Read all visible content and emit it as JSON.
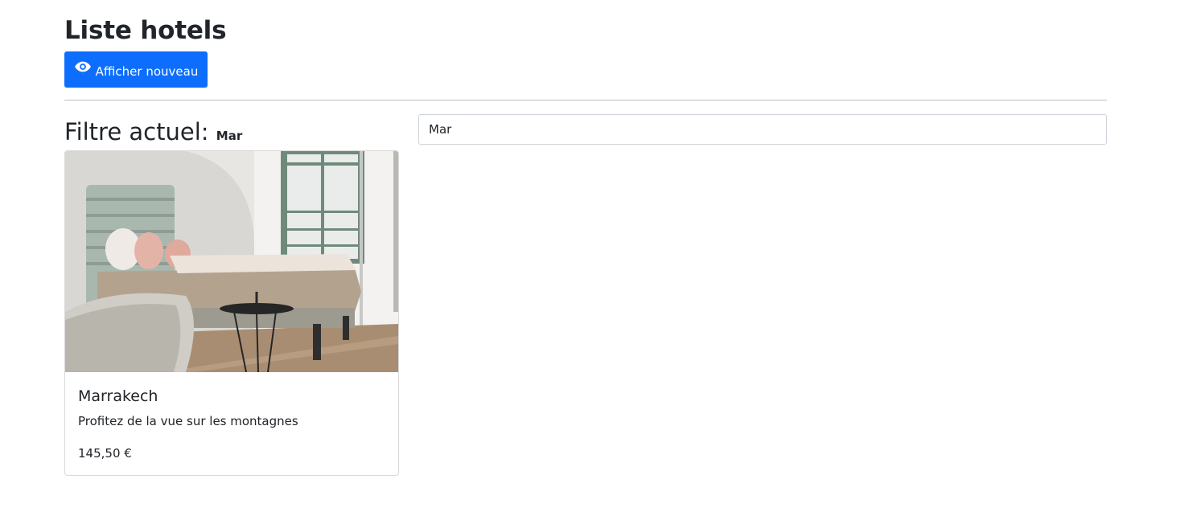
{
  "page": {
    "title": "Liste hotels"
  },
  "toolbar": {
    "show_new_label": "Afficher nouveau",
    "show_new_icon": "eye-icon"
  },
  "filter": {
    "heading_label": "Filtre actuel:",
    "current_value": "Mar"
  },
  "search": {
    "value": "Mar"
  },
  "hotels": [
    {
      "name": "Marrakech",
      "description": "Profitez de la vue sur les montagnes",
      "price": "145,50 €",
      "image": "hotel-room-photo"
    }
  ],
  "colors": {
    "primary": "#0d6efd",
    "text": "#212529",
    "divider": "#bdbdbd"
  }
}
